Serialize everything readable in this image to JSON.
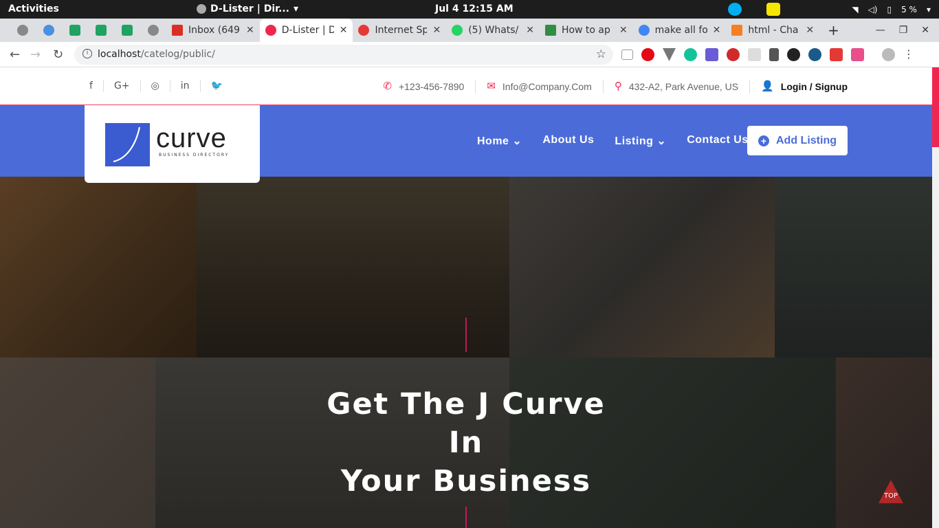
{
  "os": {
    "activities": "Activities",
    "window_title": "D-Lister | Dir...",
    "clock": "Jul 4  12:15 AM",
    "battery": "5 %"
  },
  "tabs": [
    {
      "label": "Inbox (649"
    },
    {
      "label": "D-Lister | D"
    },
    {
      "label": "Internet Sp"
    },
    {
      "label": "(5) Whats/"
    },
    {
      "label": "How to ap"
    },
    {
      "label": "make all fo"
    },
    {
      "label": "html - Cha"
    }
  ],
  "address": {
    "host": "localhost",
    "path": "/catelog/public/"
  },
  "site": {
    "phone": "+123-456-7890",
    "email": "Info@Company.Com",
    "address": "432-A2, Park Avenue, US",
    "login": "Login / Signup",
    "logo_word": "curve",
    "logo_tagline": "BUSINESS DIRECTORY",
    "menu": [
      "Home",
      "About Us",
      "Listing",
      "Contact Us"
    ],
    "add_listing": "Add Listing",
    "hero_line1": "Get The J Curve In",
    "hero_line2": "Your Business",
    "top_label": "TOP"
  },
  "colors": {
    "accent": "#f1264f",
    "nav": "#4b6cd8"
  },
  "icons": [
    "facebook-icon",
    "google-plus-icon",
    "instagram-icon",
    "linkedin-icon",
    "twitter-icon"
  ]
}
